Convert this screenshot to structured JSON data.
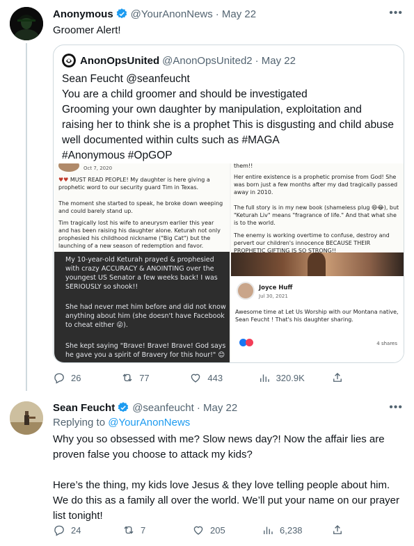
{
  "tweet1": {
    "name": "Anonymous",
    "handle": "@YourAnonNews",
    "date": "· May 22",
    "text": "Groomer Alert!",
    "quote": {
      "name": "AnonOpsUnited",
      "handle": "@AnonOpsUnited2",
      "date": "· May 22",
      "text": "Sean Feucht @seanfeucht\nYou are a child groomer and should be investigated\nGrooming your own daughter by manipulation, exploitation and raising her to think she is a prophet This is disgusting and child abuse well documented within cults such as #MAGA\n#Anonymous #OpGOP",
      "media": {
        "left_date": "Oct 7, 2020",
        "left_p1": "MUST READ PEOPLE! My daughter is here giving a prophetic word to our security guard Tim in Texas.",
        "left_p2": "The moment she started to speak, he broke down weeping and could barely stand up.",
        "left_p3": "Tim tragically lost his wife to aneurysm earlier this year and has been raising his daughter alone. Keturah not only prophesied his childhood nickname (\"Big Cat\") but the launching of a new season of redemption and favor.",
        "fb_p1": "My 10-year-old Keturah prayed & prophesied with crazy ACCURACY & ANOINTING over the youngest US Senator a few weeks back! I was SERIOUSLY so shook!!",
        "fb_p2": "She had never met him before and did not know anything about him (she doesn't have Facebook to cheat either 😜).",
        "fb_p3": "She kept saying \"Brave! Brave! Brave! God says he gave you a spirit of Bravery for this hour!\" 😊",
        "right_top": "them!!",
        "right_p1": "Her entire existence is a prophetic promise from God! She was born just a few months after my dad tragically passed away in 2010.",
        "right_p2": "The full story is in my new book (shameless plug 😄😂), but \"Keturah Liv\" means \"fragrance of life.\" And that what she is to the world.",
        "right_p3": "The enemy is working overtime to confuse, destroy and pervert our children's innocence BECAUSE THEIR PROPHETIC GIFTING IS SO STRONG!!",
        "card_name": "Joyce Huff",
        "card_date": "Jul 30, 2021",
        "card_text": "Awesome time at Let Us Worship with our Montana native, Sean Feucht ! That's his daughter sharing.",
        "card_shares": "4 shares"
      }
    },
    "stats": {
      "replies": "26",
      "retweets": "77",
      "likes": "443",
      "views": "320.9K"
    }
  },
  "tweet2": {
    "name": "Sean Feucht",
    "handle": "@seanfeucht",
    "date": "· May 22",
    "replying_prefix": "Replying to",
    "replying_handle": "@YourAnonNews",
    "text": "Why you so obsessed with me? Slow news day?! Now the affair lies are proven false you choose to attack my kids?\n\nHere’s the thing, my kids love Jesus & they love telling people about him. We do this as a family all over the world. We’ll put your name on our prayer list tonight!",
    "stats": {
      "replies": "24",
      "retweets": "7",
      "likes": "205",
      "views": "6,238"
    }
  },
  "colors": {
    "accent": "#1d9bf0",
    "muted": "#536471",
    "border": "#cfd9de"
  }
}
